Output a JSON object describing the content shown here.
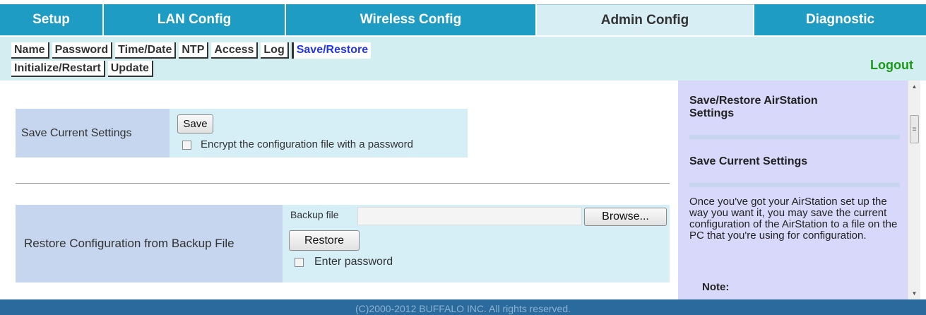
{
  "topnav": {
    "tabs": [
      {
        "label": "Setup"
      },
      {
        "label": "LAN Config"
      },
      {
        "label": "Wireless Config"
      },
      {
        "label": "Admin Config"
      },
      {
        "label": "Diagnostic"
      }
    ]
  },
  "subnav": {
    "row1": [
      "Name",
      "Password",
      "Time/Date",
      "NTP",
      "Access",
      "Log",
      "Save/Restore"
    ],
    "row2": [
      "Initialize/Restart",
      "Update"
    ],
    "logout": "Logout"
  },
  "save_section": {
    "label": "Save Current Settings",
    "button": "Save",
    "checkbox_label": "Encrypt the configuration file with a password"
  },
  "restore_section": {
    "label": "Restore Configuration from Backup File",
    "file_label": "Backup file",
    "browse_button": "Browse...",
    "restore_button": "Restore",
    "checkbox_label": "Enter password"
  },
  "help": {
    "title": "Save/Restore AirStation Settings",
    "section_heading": "Save Current Settings",
    "paragraph": "Once you've got your AirStation set up the way you want it, you may save the current configuration of the AirStation to a file on the PC that you're using for configuration.",
    "note_heading": "Note:"
  },
  "footer": {
    "text": "(C)2000-2012 BUFFALO INC. All rights reserved."
  }
}
